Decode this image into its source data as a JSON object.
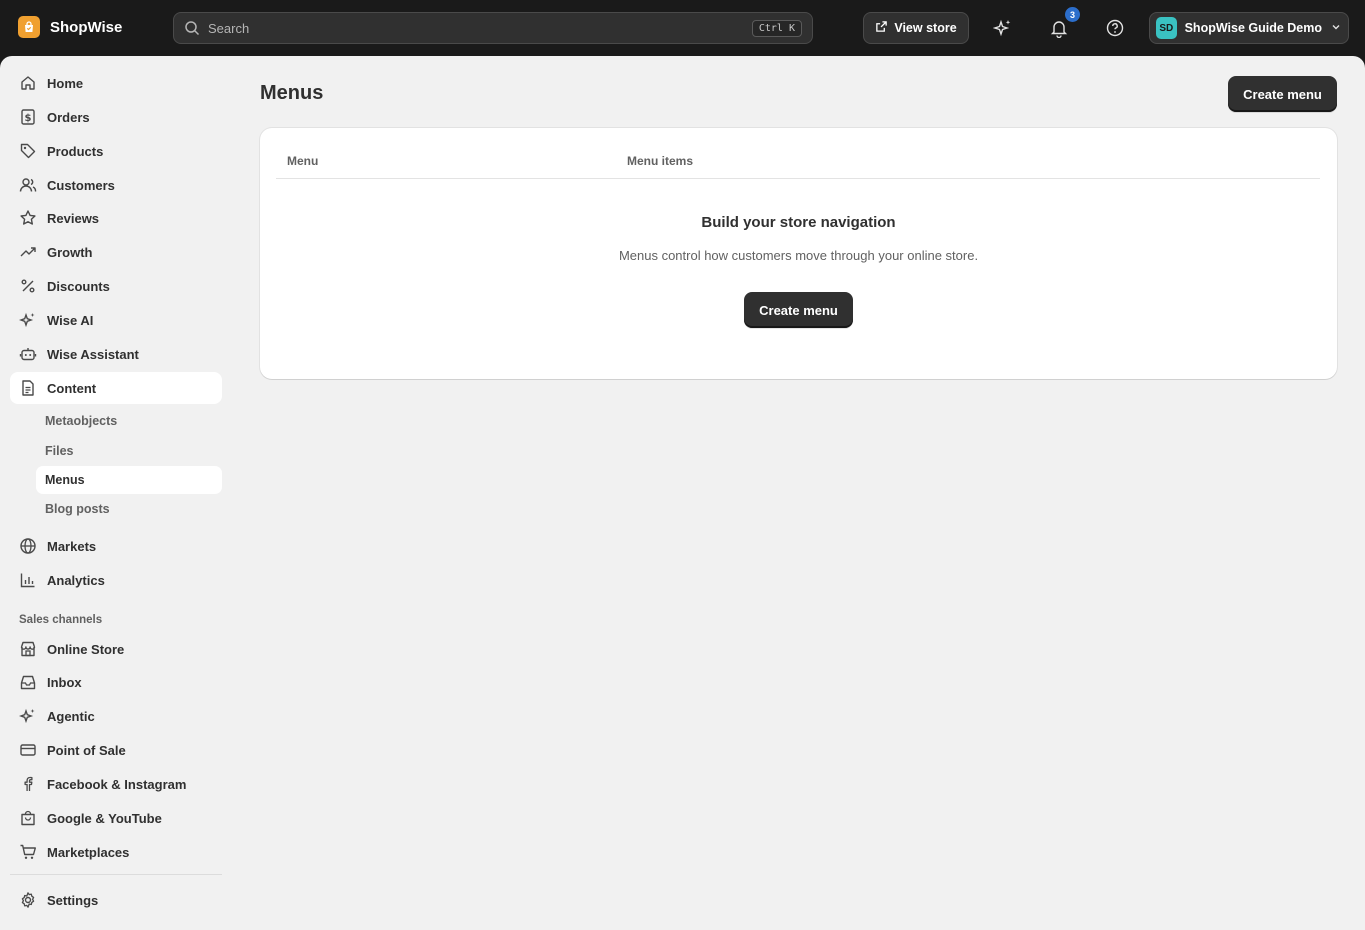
{
  "brand": {
    "name": "ShopWise"
  },
  "search": {
    "placeholder": "Search",
    "shortcut": "Ctrl K"
  },
  "topbar": {
    "view_store_label": "View store",
    "notifications_count": "3",
    "account_initials": "SD",
    "account_name": "ShopWise Guide Demo"
  },
  "sidebar": {
    "items": [
      {
        "label": "Home",
        "icon": "home-icon"
      },
      {
        "label": "Orders",
        "icon": "orders-icon"
      },
      {
        "label": "Products",
        "icon": "tag-icon"
      },
      {
        "label": "Customers",
        "icon": "customers-icon"
      },
      {
        "label": "Reviews",
        "icon": "star-icon"
      },
      {
        "label": "Growth",
        "icon": "trend-icon"
      },
      {
        "label": "Discounts",
        "icon": "percent-icon"
      },
      {
        "label": "Wise AI",
        "icon": "sparkle-icon"
      },
      {
        "label": "Wise Assistant",
        "icon": "robot-icon"
      },
      {
        "label": "Content",
        "icon": "document-icon"
      }
    ],
    "content_subitems": [
      "Metaobjects",
      "Files",
      "Menus",
      "Blog posts"
    ],
    "items_after": [
      {
        "label": "Markets",
        "icon": "globe-icon"
      },
      {
        "label": "Analytics",
        "icon": "chart-icon"
      }
    ],
    "sales_channels_title": "Sales channels",
    "channels": [
      {
        "label": "Online Store",
        "icon": "store-icon"
      },
      {
        "label": "Inbox",
        "icon": "inbox-icon"
      },
      {
        "label": "Agentic",
        "icon": "sparkle-icon"
      },
      {
        "label": "Point of Sale",
        "icon": "card-icon"
      },
      {
        "label": "Facebook & Instagram",
        "icon": "facebook-icon"
      },
      {
        "label": "Google & YouTube",
        "icon": "bag-icon"
      },
      {
        "label": "Marketplaces",
        "icon": "cart-icon"
      }
    ],
    "settings_label": "Settings"
  },
  "main": {
    "title": "Menus",
    "create_button": "Create menu",
    "table": {
      "columns": [
        "Menu",
        "Menu items"
      ]
    },
    "empty_state": {
      "title": "Build your store navigation",
      "description": "Menus control how customers move through your online store.",
      "button": "Create menu"
    }
  },
  "colors": {
    "topbar_bg": "#1a1a1a",
    "page_bg": "#f1f1f1",
    "primary_button": "#303030",
    "badge": "#2c6ecb",
    "brand_logo": "#f0a030",
    "avatar": "#3ac2c2"
  }
}
